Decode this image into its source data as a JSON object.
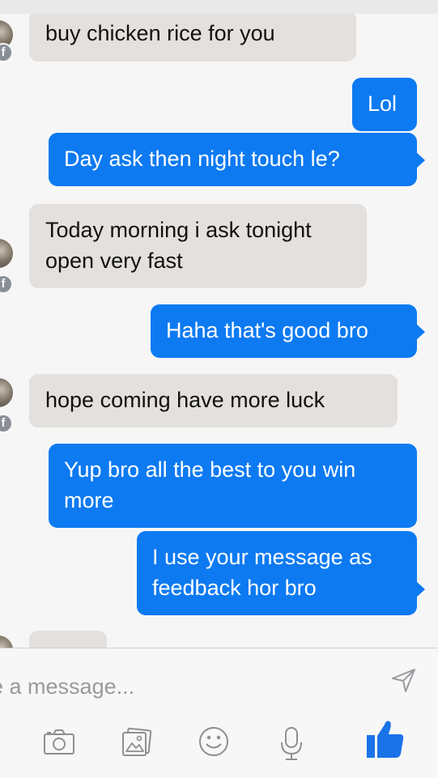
{
  "messages": [
    {
      "id": "m1",
      "side": "in",
      "text": "buy chicken rice for you"
    },
    {
      "id": "m2",
      "side": "out",
      "text": "Lol"
    },
    {
      "id": "m3",
      "side": "out",
      "text": "Day ask then night touch le?"
    },
    {
      "id": "m4",
      "side": "in",
      "lines": [
        "Today morning i ask tonight",
        "open very fast"
      ]
    },
    {
      "id": "m5",
      "side": "out",
      "text": "Haha that's good bro"
    },
    {
      "id": "m6",
      "side": "in",
      "text": "hope coming have more luck"
    },
    {
      "id": "m7",
      "side": "out",
      "lines": [
        "Yup bro all the best to you win",
        "more"
      ]
    },
    {
      "id": "m8",
      "side": "out",
      "lines": [
        "I use your message as",
        "feedback hor bro"
      ]
    },
    {
      "id": "m9",
      "side": "in",
      "text": ""
    }
  ],
  "avatar_badge": "f",
  "composer": {
    "placeholder": "pe a message...",
    "tools": [
      "camera-icon",
      "photo-gallery-icon",
      "sticker-icon",
      "microphone-icon",
      "like-icon"
    ],
    "send_icon": "send-icon"
  },
  "colors": {
    "outgoing": "#0d7af2",
    "incoming": "#e3e0dd",
    "like": "#1a73e8",
    "tool_icon": "#8e8e93"
  }
}
